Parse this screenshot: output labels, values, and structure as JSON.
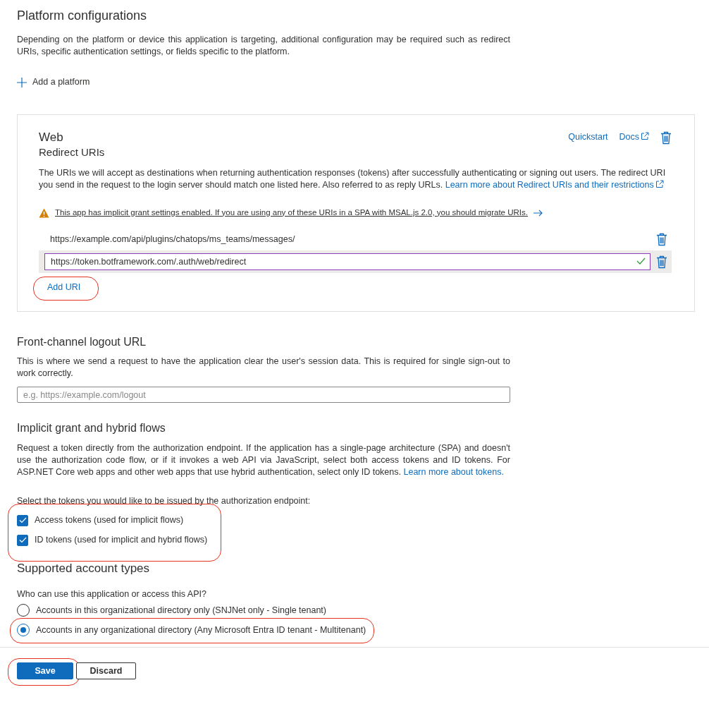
{
  "platform_section": {
    "title": "Platform configurations",
    "description": "Depending on the platform or device this application is targeting, additional configuration may be required such as redirect URIs, specific authentication settings, or fields specific to the platform.",
    "add_platform": "Add a platform"
  },
  "web_card": {
    "title": "Web",
    "subtitle": "Redirect URIs",
    "links": [
      {
        "label": "Quickstart",
        "external": false
      },
      {
        "label": "Docs",
        "external": true
      }
    ],
    "description": "The URIs we will accept as destinations when returning authentication responses (tokens) after successfully authenticating or signing out users. The redirect URI you send in the request to the login server should match one listed here. Also referred to as reply URLs.",
    "learn_more": "Learn more about Redirect URIs and their restrictions",
    "warning": "This app has implicit grant settings enabled. If you are using any of these URIs in a SPA with MSAL.js 2.0, you should migrate URIs.",
    "redirect_uris": [
      {
        "value": "https://example.com/api/plugins/chatops/ms_teams/messages/",
        "editing": false
      },
      {
        "value": "https://token.botframework.com/.auth/web/redirect",
        "editing": true
      }
    ],
    "add_uri": {
      "label": "Add URI",
      "highlighted": true
    }
  },
  "logout": {
    "title": "Front-channel logout URL",
    "description": "This is where we send a request to have the application clear the user's session data. This is required for single sign-out to work correctly.",
    "placeholder": "e.g. https://example.com/logout"
  },
  "implicit": {
    "title": "Implicit grant and hybrid flows",
    "description": "Request a token directly from the authorization endpoint. If the application has a single-page architecture (SPA) and doesn't use the authorization code flow, or if it invokes a web API via JavaScript, select both access tokens and ID tokens. For ASP.NET Core web apps and other web apps that use hybrid authentication, select only ID tokens.",
    "learn_more": "Learn more about tokens.",
    "prompt": "Select the tokens you would like to be issued by the authorization endpoint:",
    "highlighted": true,
    "tokens": [
      {
        "label": "Access tokens (used for implicit flows)",
        "checked": true
      },
      {
        "label": "ID tokens (used for implicit and hybrid flows)",
        "checked": true
      }
    ]
  },
  "account_types": {
    "title": "Supported account types",
    "prompt": "Who can use this application or access this API?",
    "options": [
      {
        "label": "Accounts in this organizational directory only (SNJNet only - Single tenant)",
        "selected": false,
        "highlighted": false
      },
      {
        "label": "Accounts in any organizational directory (Any Microsoft Entra ID tenant - Multitenant)",
        "selected": true,
        "highlighted": true
      }
    ]
  },
  "buttons": [
    {
      "label": "Save",
      "kind": "primary",
      "highlighted": true
    },
    {
      "label": "Discard",
      "kind": "secondary",
      "highlighted": false
    }
  ]
}
